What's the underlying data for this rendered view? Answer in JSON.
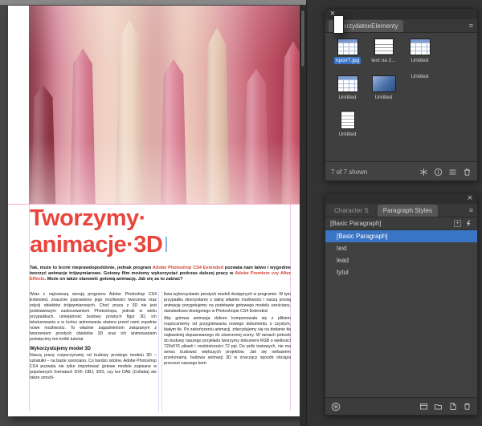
{
  "colors": {
    "accent_blue": "#3a74c4",
    "heading_red": "#e8463d",
    "panel_bg": "#424242",
    "app_bg": "#333333"
  },
  "icons": {
    "close": "×",
    "panel_menu": "≡",
    "plus_badge": "+",
    "library_footer": [
      "asterisk-icon",
      "info-icon",
      "list-icon",
      "trash-icon"
    ],
    "styles_footer": [
      "asterisk-circle-icon",
      "panel-icon",
      "folder-icon",
      "new-style-icon",
      "trash-icon"
    ]
  },
  "document": {
    "heading_line1": "Tworzymy·",
    "heading_line2": "animacje·3D",
    "lead_1": "Tak, może to brzmi nieprawdopodobnie, jednak program ",
    "lead_em1": "Adobe Photoshop CS4 Extended",
    "lead_2": " pozwala nam łatwo i wygodnie tworzyć animacje trójwymiarowe. Gotowy film możemy wykorzystać podczas dalszej pracy w ",
    "lead_em2": "Adobe Premiere czy After Effects",
    "lead_3": ". Może on także stanowić gotową animację. Jak się za to zabrać?",
    "col1_p1": "Wraz z najnowszą wersją programu Adobe Photoshop CS4 Extended, znacznie poprawiono jego możliwości tworzenia oraz edycji obiektów trójwymiarowych. Choć praca z 3D nie jest podstawowym zastosowaniem Photoshopa, jednak w wielu przypadkach, umiejętność budowy prostych figur 3D, ich teksturowania a w końcu animowania otwiera przed nami zupełnie nowe możliwości. To właśnie zagadnieniom związanym z tworzeniem prostych obiektów 3D oraz ich animowaniem poświęcimy ten krótki tutorial.",
    "col1_subhead": "Wykorzystujemy model 3D",
    "col1_p2": "Naszą pracę rozpoczynamy od budowy prostego modelu 3D – szkatułki – na bazie sześcianu. Co bardzo istotne, Adobe Photoshop CS4 pozwala nie tylko importować gotowe modele zapisane w popularnych formatach DXF, OBJ, 3DS, czy też DAE (Collada) ale także umożli-",
    "col2_p1": "liwia wykorzystanie prostych modeli dostępnych w programie. W tym przypadku skorzystamy z takiej właśnie możliwości i naszą prostą animację przygotujemy na podstawie gotowego modelu sześcianu, standardowo dostępnego w Photoshopie CS4 Extended.",
    "col2_p2": "Aby gotowa animacja dobrze komponowała się z plikiem rozpoczniemy od przygotowania nowego dokumentu o czystym, białym tle. Po zakończeniu animacji, zdecydujemy się na dodanie tła najbardziej dopasowanego do utworzonej sceny. W ramach potrzeb do budowy naszego przykładu tworzymy dokument RGB o wielkości 720x576 pikseli i rozdzielczości 72 ppi. Do prób testowych, nie ma sensu budować większych projektów. Jak się niebawem przekonamy, budowa animacji 3D w znaczący sposób obciąża procesor naszego kom-"
  },
  "library_panel": {
    "title": "przydatneElementy",
    "status": "7 of 7 shown",
    "items": [
      {
        "label": "nporr7.jpg"
      },
      {
        "label": "text na 2..."
      },
      {
        "label": "Untitled"
      },
      {
        "label": "Untitled"
      },
      {
        "label": "Untitled"
      },
      {
        "label": "Untitled"
      },
      {
        "label": "Untitled"
      }
    ]
  },
  "styles_panel": {
    "tab_character": "Character S",
    "tab_paragraph": "Paragraph Styles",
    "current_style": "[Basic Paragraph]",
    "styles": [
      {
        "name": "[Basic Paragraph]"
      },
      {
        "name": "text"
      },
      {
        "name": "lead"
      },
      {
        "name": "tytul"
      }
    ]
  }
}
